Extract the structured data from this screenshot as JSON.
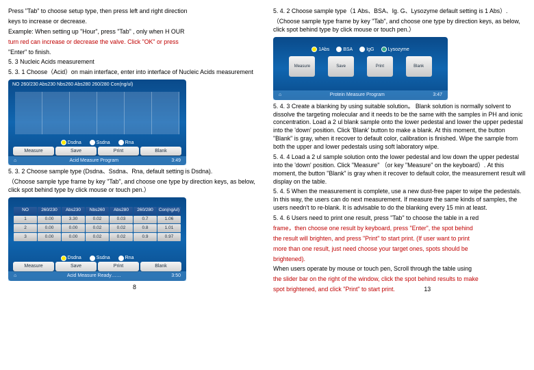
{
  "left": {
    "p1": "Press \"Tab\" to choose setup type, then press left and right direction",
    "p2": "keys to increase or decrease.",
    "p3a": "Example: When setting up \"Hour\", press \"Tab\" , only when H OUR",
    "p3b": "turn red can increase or decrease the valve. Click \"OK\" or press",
    "p4": "\"Enter\" to finish.",
    "h53": "5. 3 Nucleic Acids measurement",
    "p531": "5. 3. 1 Choose（Acid）on main interface, enter into interface of Nucleic Acids measurement",
    "p532a": "5. 3. 2 Choose sample type (Dsdna、Ssdna、Rna, default setting is Dsdna).",
    "p532b": "（Choose sample type frame by key \"Tab\", and choose one type by direction keys, as below, click spot behind type by click mouse or touch pen.）",
    "page": "8"
  },
  "right": {
    "p542a": "5. 4. 2 Choose sample type（1 Abs、BSA、Ig. G、Lysozyme default setting is 1 Abs）.",
    "p542b": "（Choose sample type frame by key \"Tab\", and choose one type by direction keys, as below, click spot behind type by click mouse or touch pen.）",
    "p543": "5. 4. 3 Create a blanking by using suitable solution。 Blank solution is normally solvent to dissolve the targeting molecular and it needs to be the same with the samples in PH and ionic concentration. Load a 2 ul blank sample onto the lower pedestal and lower the upper pedestal into the 'down' position. Click 'Blank' button to make a blank. At this moment, the button \"Blank\" is gray, when it recover to default color, calibration is finished. Wipe the sample from both the upper and lower pedestals using soft laboratory wipe.",
    "p544": "5. 4. 4 Load a 2 ul sample solution onto the lower pedestal and low down the upper pedestal into the 'down' position. Click \"Measure\" （or key \"Measure\" on the keyboard）. At this moment, the button \"Blank\" is gray when it recover to default color, the measurement result will display on the table.",
    "p545": "5. 4. 5 When the measurement is complete, use a new dust-free paper to wipe the pedestals. In this way, the users can do next measurement. If measure the same kinds of samples, the users needn't to re-blank. It is advisable to do the blanking every 15 min at least.",
    "p546a": "5. 4. 6 Users need to print one result, press \"Tab\" to choose the table in a red",
    "p546b": "frame，then choose one result by keyboard, press \"Enter\", the spot behind",
    "p546c": "the result will brighten, and press \"Print\" to start print. (If user want to print",
    "p546d": "more than one result, just need choose your target ones, spots should be",
    "p546e": "brightened).",
    "p546f": "When users operate by mouse or touch pen, Scroll through the table using",
    "p546g": "the slider bar on the right of the window, click the spot behind results to make",
    "p546h": "spot brightened, and click \"Print\" to start print.",
    "page": "13"
  },
  "s1": {
    "hdr": "NO    260/230  Abs230  Nbs260  Abs280  260/280 Con(ng/ul)",
    "c1": "Dsdna",
    "c2": "Ssdna",
    "c3": "Rna",
    "b1": "Measure",
    "b2": "Save",
    "b3": "Print",
    "b4": "Blank",
    "ftr": "Acid Measure Program",
    "time": "3:49"
  },
  "s2": {
    "h": [
      "NO",
      "260/230",
      "Abs230",
      "Nbs260",
      "Abs280",
      "260/280",
      "Con(ng/ul)"
    ],
    "r1": [
      "1",
      "0.00",
      "3.30",
      "0.02",
      "0.03",
      "0.7",
      "1.06"
    ],
    "r2": [
      "2",
      "0.00",
      "0.00",
      "0.02",
      "0.02",
      "0.8",
      "1.01"
    ],
    "r3": [
      "3",
      "0.00",
      "0.00",
      "0.02",
      "0.02",
      "0.9",
      "0.97"
    ],
    "c1": "Dsdna",
    "c2": "Ssdna",
    "c3": "Rna",
    "b1": "Measure",
    "b2": "Save",
    "b3": "Print",
    "b4": "Blank",
    "ftr": "Acid Measure Ready……",
    "time": "3:50"
  },
  "s3": {
    "c1": "1Abs",
    "c2": "BSA",
    "c3": "IgG",
    "c4": "Lysozyme",
    "i1": "Measure",
    "i2": "Save",
    "i3": "Print",
    "i4": "Blank",
    "ftr": "Protein Measure Program",
    "time": "3:47"
  }
}
